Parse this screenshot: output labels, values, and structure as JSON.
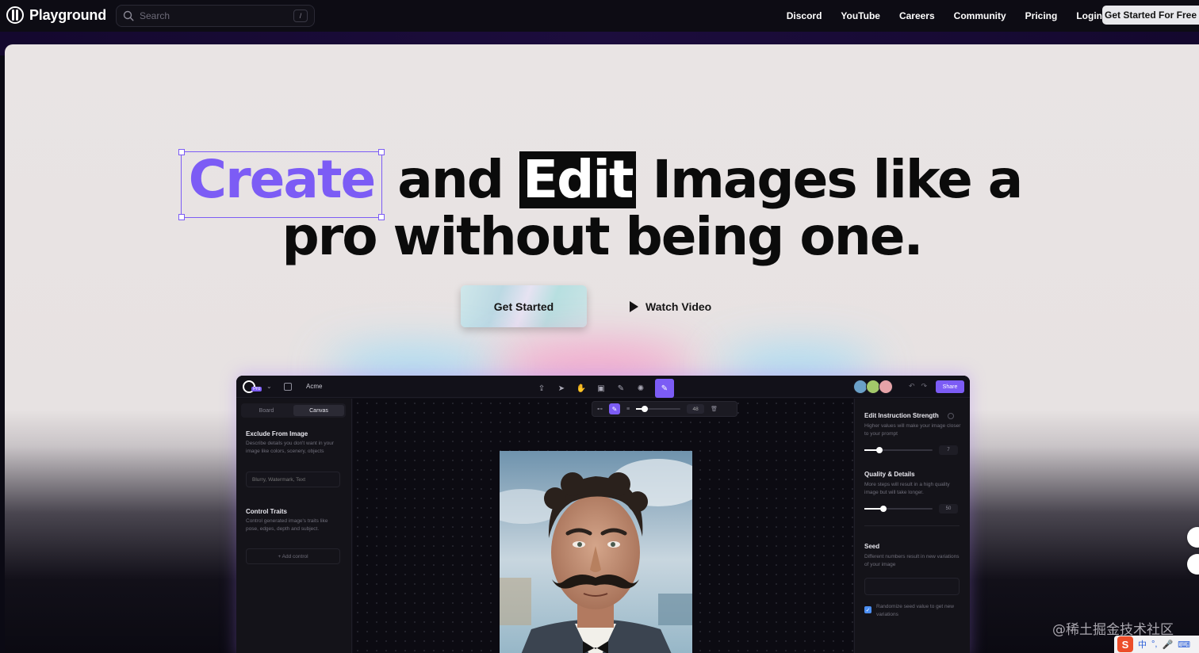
{
  "nav": {
    "brand": "Playground",
    "search_placeholder": "Search",
    "search_shortcut": "/",
    "links": [
      "Discord",
      "YouTube",
      "Careers",
      "Community",
      "Pricing",
      "Login"
    ],
    "cta": "Get Started For Free"
  },
  "hero": {
    "headline_create": "Create",
    "headline_and": "and",
    "headline_edit": "Edit",
    "headline_rest1": "Images like a",
    "headline_line2": "pro without being one.",
    "primary_button": "Get Started",
    "secondary_button": "Watch Video"
  },
  "app": {
    "project_name": "Acme",
    "pro_badge": "Pro",
    "share_label": "Share",
    "tabs": [
      "Board",
      "Canvas"
    ],
    "active_tab": "Canvas",
    "brush_size": "48",
    "left_panel": {
      "exclude_title": "Exclude From Image",
      "exclude_desc": "Describe details you don't want in your image like colors, scenery, objects",
      "exclude_placeholder": "Blurry, Watermark, Text",
      "control_title": "Control Traits",
      "control_desc": "Control generated image's traits like pose, edges, depth and subject.",
      "add_control": "+ Add control"
    },
    "right_panel": {
      "strength_title": "Edit Instruction Strength",
      "strength_desc": "Higher values will make your image closer to your prompt",
      "strength_value": "7",
      "quality_title": "Quality & Details",
      "quality_desc": "More steps will result in a high quality image but will take longer.",
      "quality_value": "50",
      "seed_title": "Seed",
      "seed_desc": "Different numbers result in new variations of your image",
      "randomize_label": "Randomize seed value to get new variations",
      "randomize_checked": true
    }
  },
  "overlay": {
    "watermark": "@稀土掘金技术社区",
    "ime_items": [
      "中",
      "°,",
      "🎤",
      "⌨",
      "👕"
    ]
  },
  "colors": {
    "accent": "#7c5cf5",
    "headline": "#0b0b0b",
    "hero_bg": "#e9e4e4",
    "nav_bg": "#0d0c14"
  }
}
